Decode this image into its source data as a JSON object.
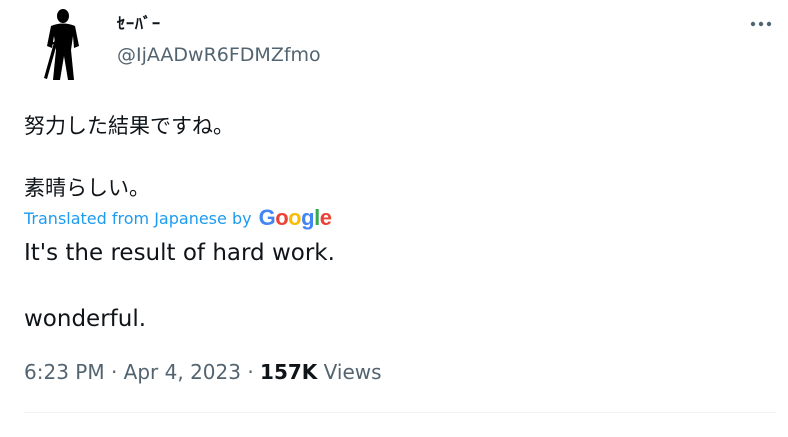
{
  "author": {
    "display_name": "ｾｰﾊﾞｰ",
    "handle": "@IjAADwR6FDMZfmo",
    "avatar_icon": "silhouette-figure-icon"
  },
  "more_icon": "more-horizontal-icon",
  "tweet": {
    "original_lines": [
      "努力した結果ですね。",
      "素晴らしい。"
    ],
    "translation_label": "Translated from Japanese by",
    "translation_provider": "Google",
    "translated_lines": [
      "It's the result of hard work.",
      "wonderful."
    ]
  },
  "meta": {
    "time": "6:23 PM",
    "separator": "·",
    "date": "Apr 4, 2023",
    "views_count": "157K",
    "views_label": "Views"
  },
  "colors": {
    "text": "#0f1419",
    "secondary": "#536471",
    "link": "#1d9bf0",
    "divider": "#eff3f4",
    "google_blue": "#4285F4",
    "google_red": "#EA4335",
    "google_yellow": "#FBBC05",
    "google_green": "#34A853"
  }
}
